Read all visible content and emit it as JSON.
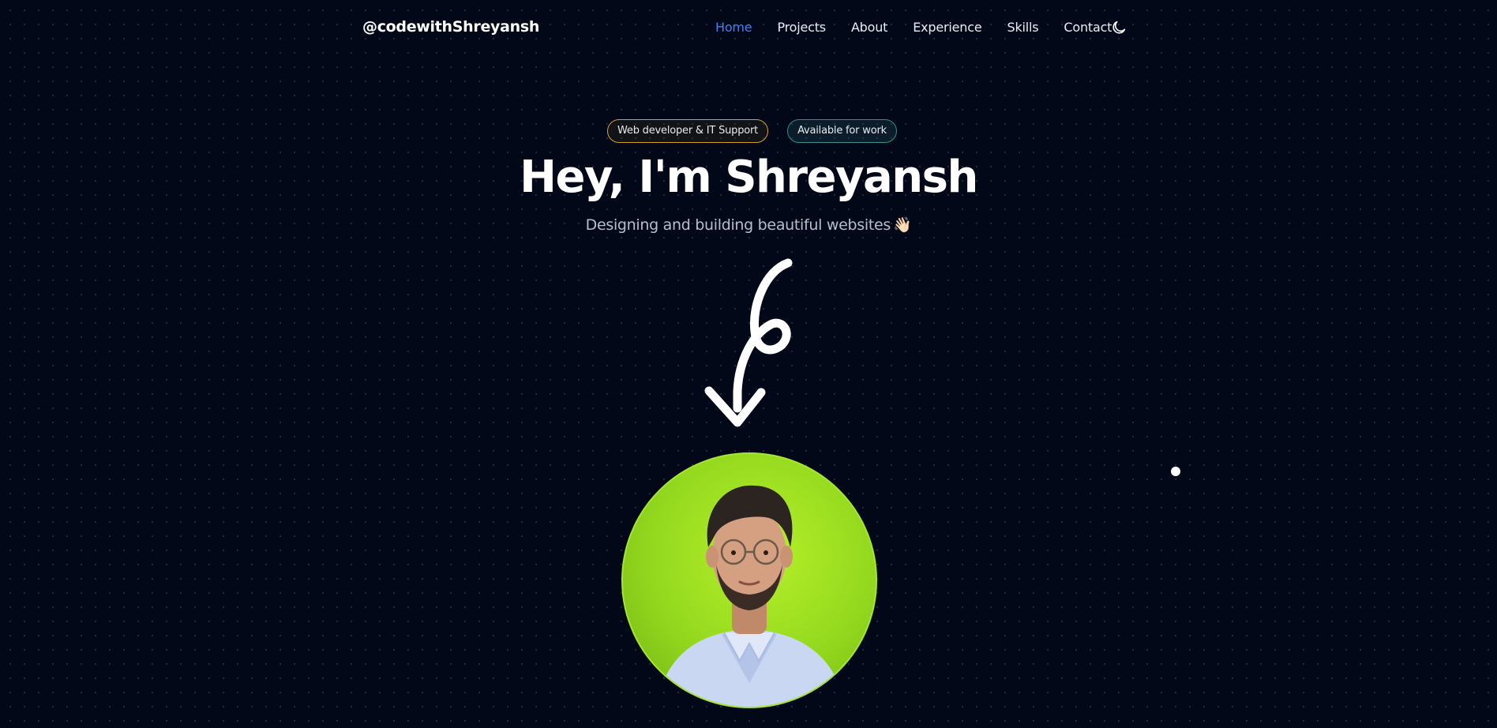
{
  "nav": {
    "brand": "@codewithShreyansh",
    "links": [
      {
        "label": "Home",
        "active": true
      },
      {
        "label": "Projects",
        "active": false
      },
      {
        "label": "About",
        "active": false
      },
      {
        "label": "Experience",
        "active": false
      },
      {
        "label": "Skills",
        "active": false
      },
      {
        "label": "Contact",
        "active": false
      }
    ],
    "theme_toggle_icon": "moon-icon",
    "active_color": "#3b82f6"
  },
  "hero": {
    "badges": [
      {
        "label": "Web developer & IT Support",
        "border_color": "#d6a12a"
      },
      {
        "label": "Available for work",
        "border_color": "#2f8f86"
      }
    ],
    "headline": "Hey, I'm Shreyansh",
    "subtitle": "Designing and building beautiful websites",
    "subtitle_emoji": "👋🏻",
    "arrow_icon": "curly-arrow-down-icon",
    "avatar_icon": "profile-photo",
    "avatar_ring_color": "#a3e635"
  },
  "colors": {
    "background": "#030818",
    "text": "#ffffff",
    "muted_text": "#b8bdc9"
  }
}
